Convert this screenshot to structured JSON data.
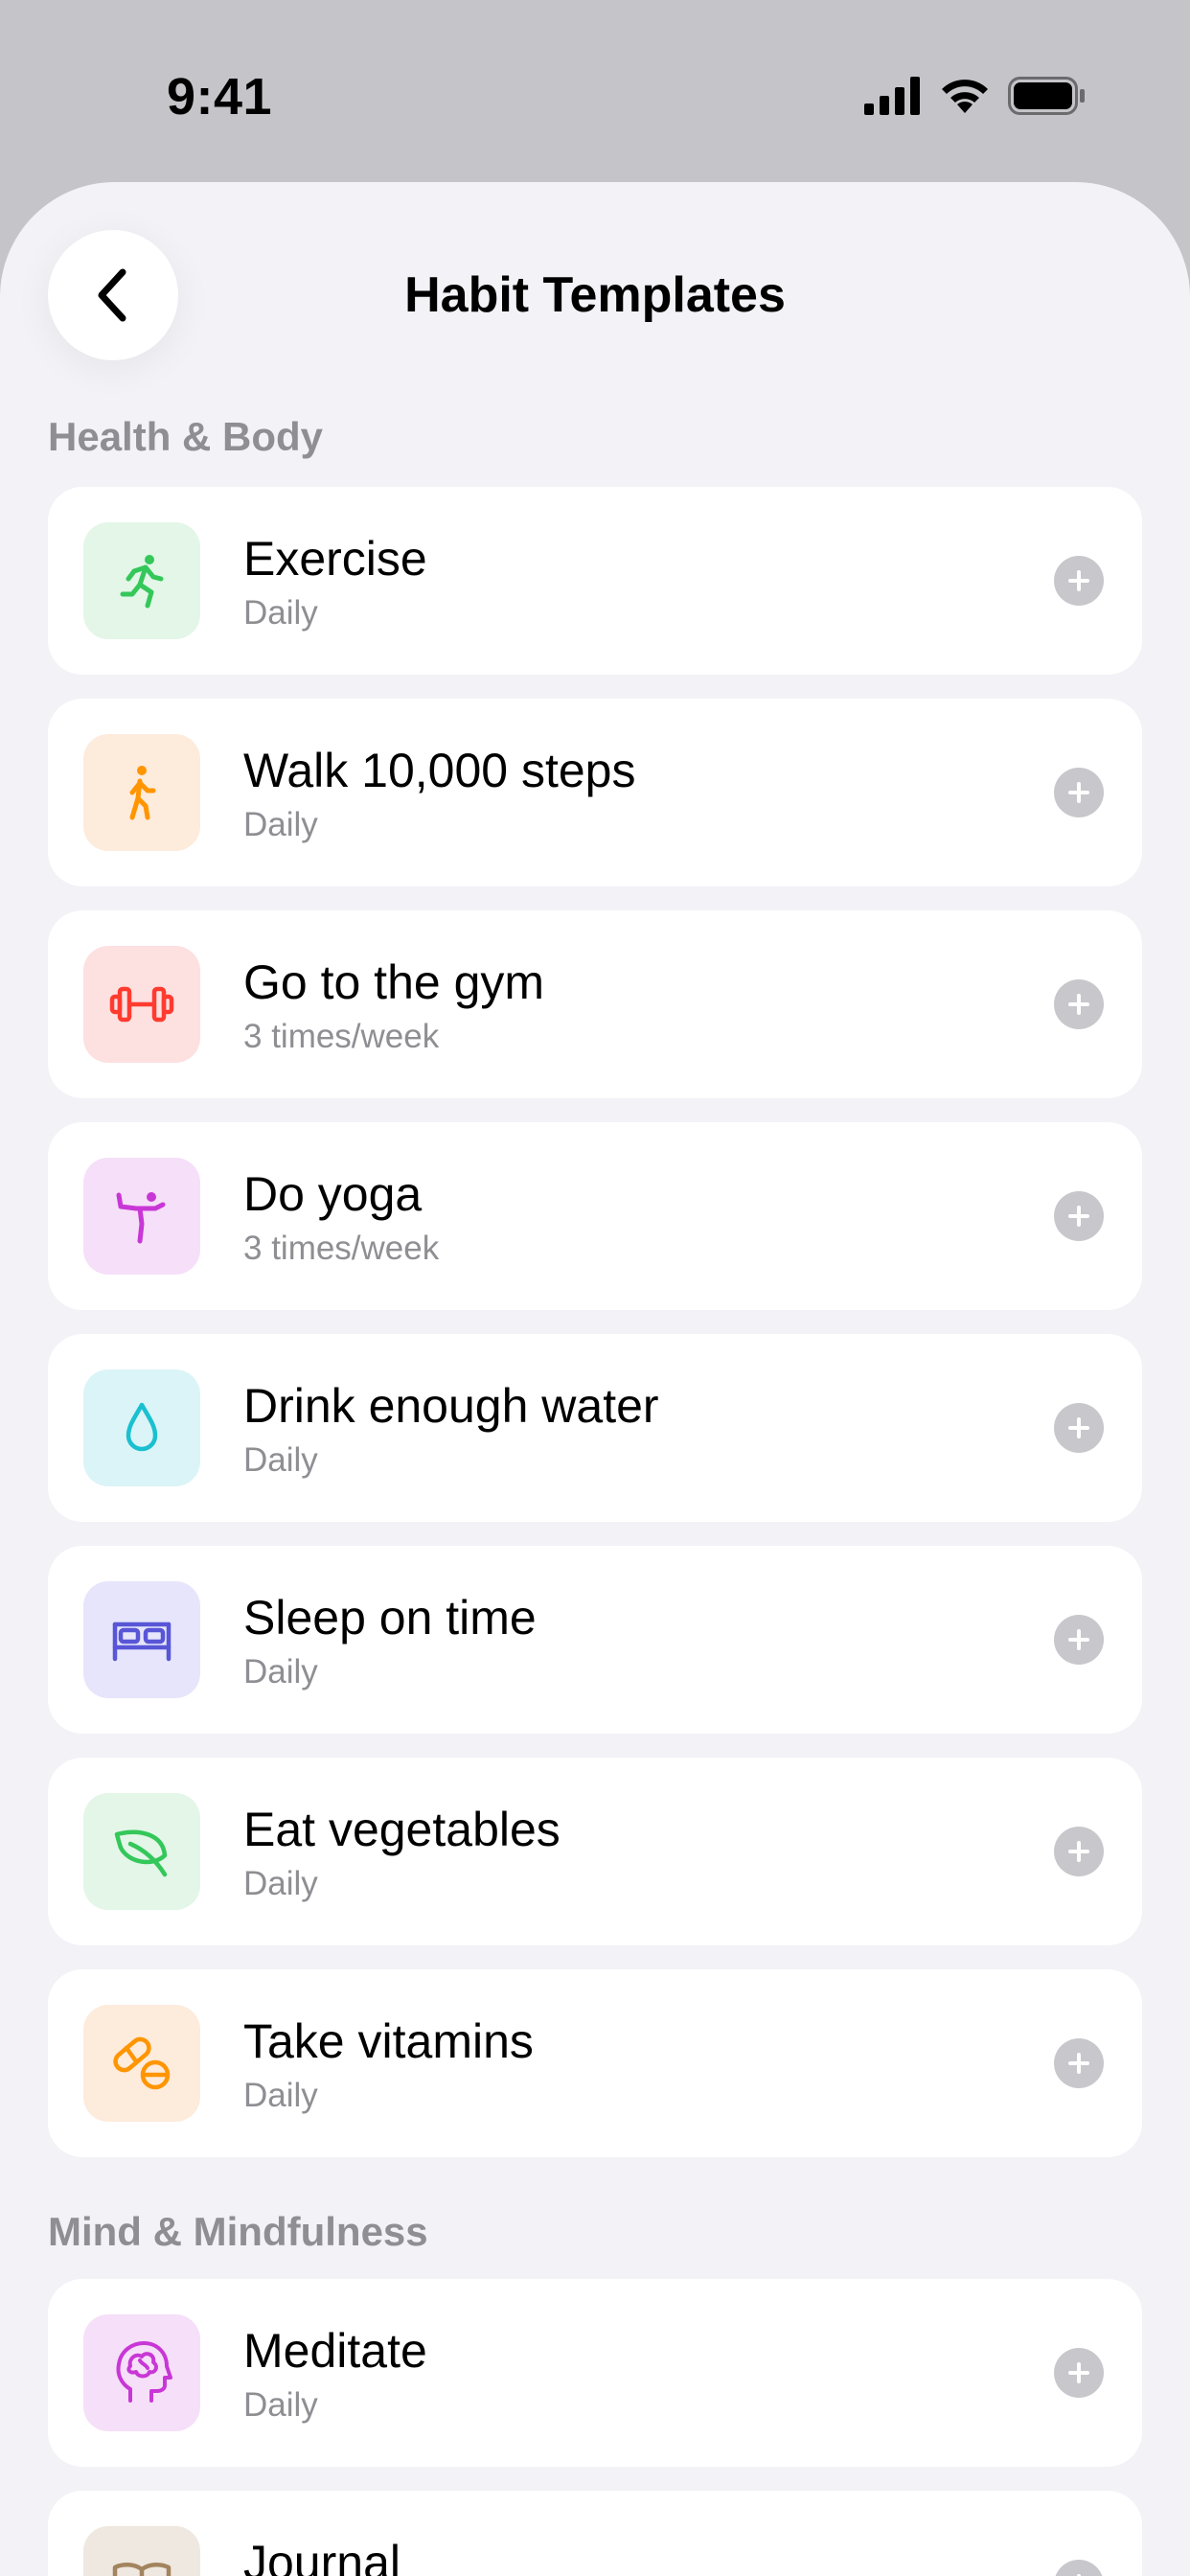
{
  "status": {
    "time": "9:41"
  },
  "header": {
    "title": "Habit Templates",
    "back_icon": "chevron-left-icon"
  },
  "sections": [
    {
      "title": "Health & Body"
    },
    {
      "title": "Mind & Mindfulness"
    }
  ],
  "habits": [
    {
      "title": "Exercise",
      "frequency": "Daily",
      "icon": "running-icon",
      "color": "#34c759",
      "tile": "#e3f6e8"
    },
    {
      "title": "Walk 10,000 steps",
      "frequency": "Daily",
      "icon": "walking-icon",
      "color": "#ff9500",
      "tile": "#fdebdc"
    },
    {
      "title": "Go to the gym",
      "frequency": "3 times/week",
      "icon": "dumbbell-icon",
      "color": "#ff3b30",
      "tile": "#fde0e0"
    },
    {
      "title": "Do yoga",
      "frequency": "3 times/week",
      "icon": "yoga-icon",
      "color": "#c837d6",
      "tile": "#f6dff8"
    },
    {
      "title": "Drink enough water",
      "frequency": "Daily",
      "icon": "water-drop-icon",
      "color": "#1ac0d0",
      "tile": "#dbf4f7"
    },
    {
      "title": "Sleep on time",
      "frequency": "Daily",
      "icon": "bed-icon",
      "color": "#5856d6",
      "tile": "#e6e5fb"
    },
    {
      "title": "Eat vegetables",
      "frequency": "Daily",
      "icon": "leaf-icon",
      "color": "#34c759",
      "tile": "#e3f6e8"
    },
    {
      "title": "Take vitamins",
      "frequency": "Daily",
      "icon": "pills-icon",
      "color": "#ff9500",
      "tile": "#fdebdc"
    },
    {
      "title": "Meditate",
      "frequency": "Daily",
      "icon": "brain-head-icon",
      "color": "#c837d6",
      "tile": "#f6dff8"
    },
    {
      "title": "Journal",
      "frequency": "",
      "icon": "book-icon",
      "color": "#a2845e",
      "tile": "#efe8e0"
    }
  ],
  "add_icon": "plus-icon"
}
